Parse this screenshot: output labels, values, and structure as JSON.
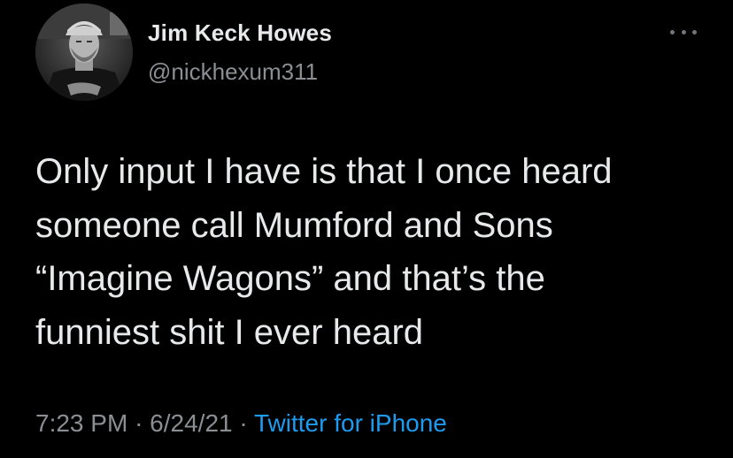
{
  "author": {
    "display_name": "Jim Keck Howes",
    "handle": "@nickhexum311",
    "avatar_icon": "profile-photo"
  },
  "more_icon": "more-horizontal-icon",
  "tweet": {
    "lines": [
      "Only input I have is that I once heard",
      "someone call Mumford and Sons",
      "“Imagine Wagons” and that’s the",
      "funniest shit I ever heard"
    ]
  },
  "meta": {
    "time": "7:23 PM",
    "separator": "·",
    "date": "6/24/21",
    "source": "Twitter for iPhone"
  },
  "colors": {
    "background": "#000000",
    "text": "#e7e9ea",
    "muted": "#8b8f93",
    "link": "#1d9bf0"
  }
}
